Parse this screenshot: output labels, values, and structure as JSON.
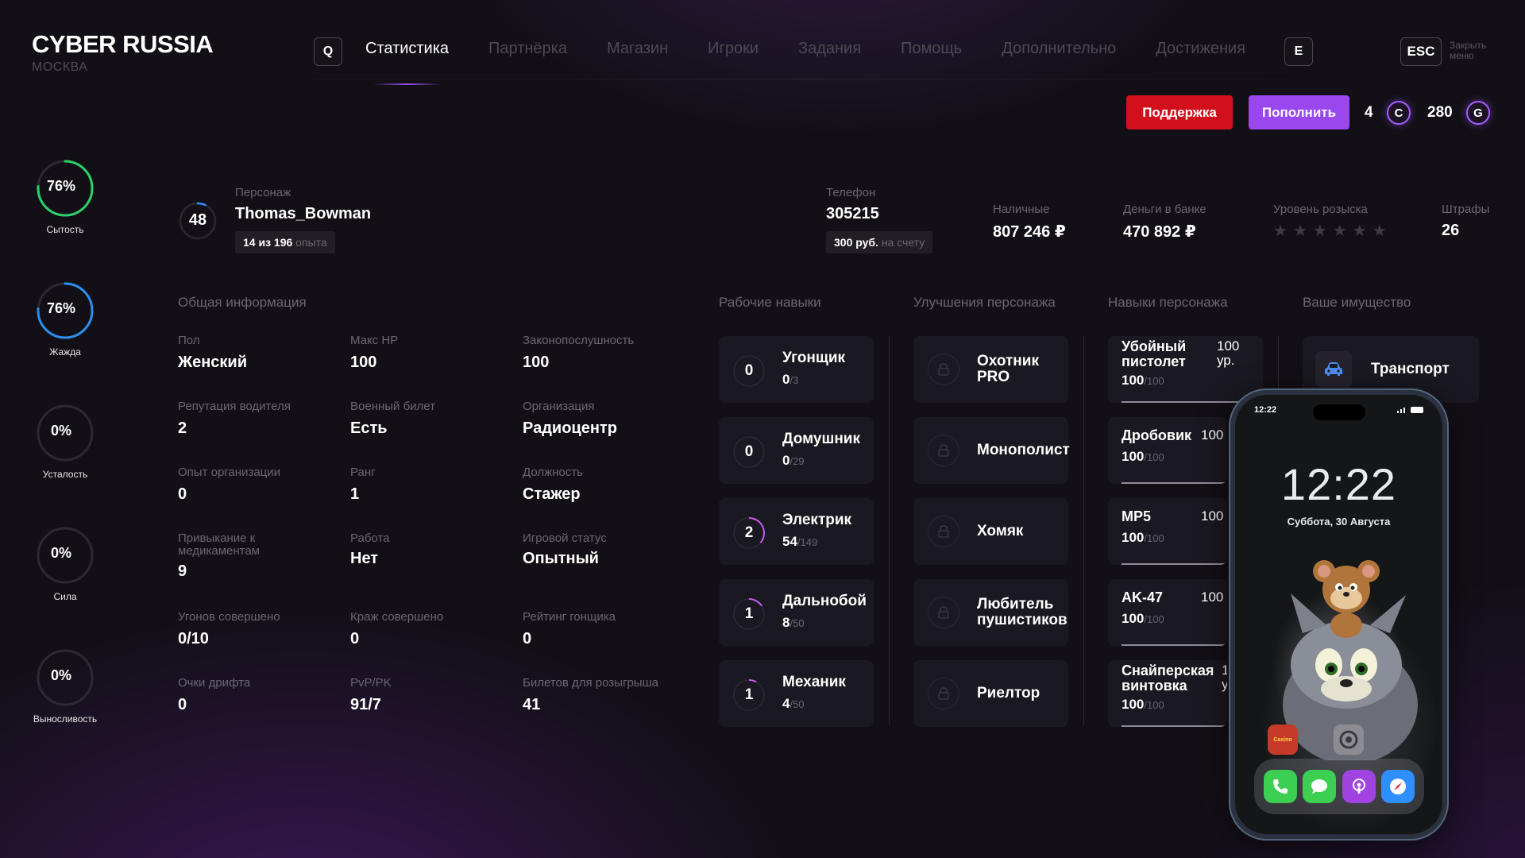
{
  "header": {
    "logo": "CYBER RUSSIA",
    "city": "МОСКВА",
    "key_left": "Q",
    "key_right": "E",
    "key_esc": "ESC",
    "close_menu": "Закрыть меню",
    "nav": [
      "Статистика",
      "Партнёрка",
      "Магазин",
      "Игроки",
      "Задания",
      "Помощь",
      "Дополнительно",
      "Достижения"
    ],
    "active_tab": "Статистика",
    "support_label": "Поддержка",
    "topup_label": "Пополнить",
    "currency_c_value": "4",
    "currency_c_symbol": "C",
    "currency_g_value": "280",
    "currency_g_symbol": "G"
  },
  "needs": [
    {
      "label": "Сытость",
      "value": 76,
      "text": "76%",
      "color": "#2bd16b"
    },
    {
      "label": "Жажда",
      "value": 76,
      "text": "76%",
      "color": "#2b8ff0"
    },
    {
      "label": "Усталость",
      "value": 0,
      "text": "0%",
      "color": "#555"
    },
    {
      "label": "Сила",
      "value": 0,
      "text": "0%",
      "color": "#555"
    },
    {
      "label": "Выносливость",
      "value": 0,
      "text": "0%",
      "color": "#555"
    }
  ],
  "profile": {
    "level": "48",
    "level_progress": 0.07,
    "character_label": "Персонаж",
    "character_name": "Thomas_Bowman",
    "exp_value": "14 из 196",
    "exp_unit": "опыта",
    "phone_label": "Телефон",
    "phone_number": "305215",
    "phone_balance": "300 руб.",
    "phone_balance_note": "на счету",
    "cash_label": "Наличные",
    "cash_value": "807 246 ₽",
    "bank_label": "Деньги в банке",
    "bank_value": "470 892 ₽",
    "wanted_label": "Уровень розыска",
    "wanted_stars": 6,
    "wanted_level": 0,
    "fines_label": "Штрафы",
    "fines_value": "26"
  },
  "sections": {
    "general": "Общая информация",
    "work": "Рабочие навыки",
    "upgrades": "Улучшения персонажа",
    "skills": "Навыки персонажа",
    "property": "Ваше имущество"
  },
  "general_info": [
    {
      "label": "Пол",
      "value": "Женский"
    },
    {
      "label": "Макс HP",
      "value": "100"
    },
    {
      "label": "Законопослушность",
      "value": "100"
    },
    {
      "label": "Репутация водителя",
      "value": "2"
    },
    {
      "label": "Военный билет",
      "value": "Есть"
    },
    {
      "label": "Организация",
      "value": "Радиоцентр"
    },
    {
      "label": "Опыт организации",
      "value": "0"
    },
    {
      "label": "Ранг",
      "value": "1"
    },
    {
      "label": "Должность",
      "value": "Стажер"
    },
    {
      "label": "Привыкание к медикаментам",
      "value": "9"
    },
    {
      "label": "Работа",
      "value": "Нет"
    },
    {
      "label": "Игровой статус",
      "value": "Опытный"
    },
    {
      "label": "Угонов совершено",
      "value": "0/10"
    },
    {
      "label": "Краж совершено",
      "value": "0"
    },
    {
      "label": "Рейтинг гонщика",
      "value": "0"
    },
    {
      "label": "Очки дрифта",
      "value": "0"
    },
    {
      "label": "PvP/PK",
      "value": "91/7"
    },
    {
      "label": "Билетов для розыгрыша",
      "value": "41"
    }
  ],
  "work_skills": [
    {
      "level": "0",
      "name": "Угонщик",
      "progress": "0",
      "max": "/3",
      "fraction": 0
    },
    {
      "level": "0",
      "name": "Домушник",
      "progress": "0",
      "max": "/29",
      "fraction": 0
    },
    {
      "level": "2",
      "name": "Электрик",
      "progress": "54",
      "max": "/149",
      "fraction": 0.36
    },
    {
      "level": "1",
      "name": "Дальнобой",
      "progress": "8",
      "max": "/50",
      "fraction": 0.16
    },
    {
      "level": "1",
      "name": "Механик",
      "progress": "4",
      "max": "/50",
      "fraction": 0.08
    }
  ],
  "upgrades": [
    {
      "line1": "Охотник",
      "line2": "PRO"
    },
    {
      "line1": "Монополист",
      "line2": ""
    },
    {
      "line1": "Хомяк",
      "line2": ""
    },
    {
      "line1": "Любитель",
      "line2": "пушистиков"
    },
    {
      "line1": "Риелтор",
      "line2": ""
    }
  ],
  "weapon_skills": [
    {
      "line1": "Убойный",
      "line2": "пистолет",
      "lvl1": "100",
      "lvl2": "ур.",
      "cond": "100",
      "max": "/100"
    },
    {
      "line1": "Дробовик",
      "line2": "",
      "lvl1": "100",
      "lvl2": "",
      "cond": "100",
      "max": "/100"
    },
    {
      "line1": "MP5",
      "line2": "",
      "lvl1": "100",
      "lvl2": "",
      "cond": "100",
      "max": "/100"
    },
    {
      "line1": "AK-47",
      "line2": "",
      "lvl1": "100",
      "lvl2": "",
      "cond": "100",
      "max": "/100"
    },
    {
      "line1": "Снайперская",
      "line2": "винтовка",
      "lvl1": "1",
      "lvl2": "у",
      "cond": "100",
      "max": "/100"
    }
  ],
  "property": [
    {
      "name": "Транспорт",
      "icon": "car-icon"
    }
  ],
  "phone": {
    "status_time": "12:22",
    "time": "12:22",
    "date": "Суббота, 30 Августа",
    "app_label": "Casino",
    "dock_apps": [
      "phone-icon",
      "messages-icon",
      "podcasts-icon",
      "safari-icon"
    ]
  }
}
